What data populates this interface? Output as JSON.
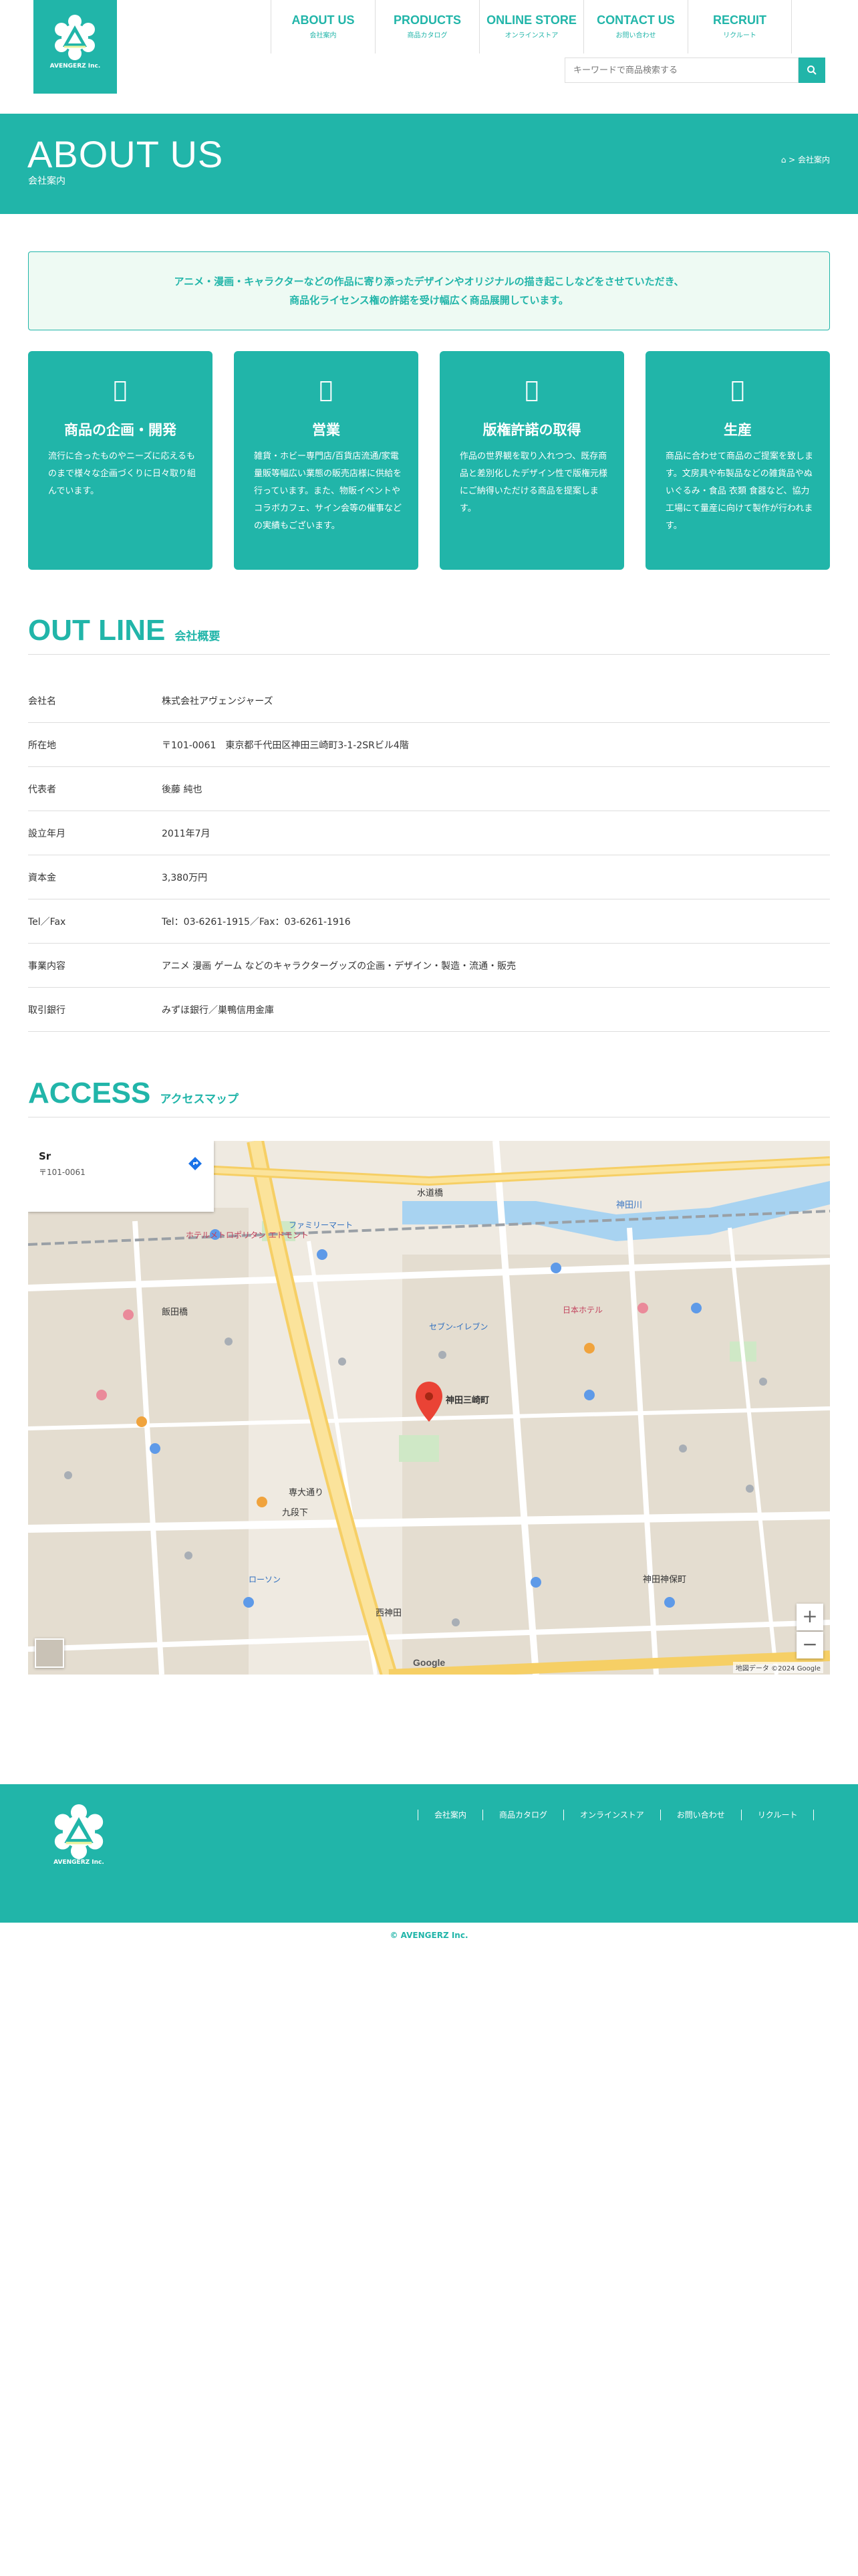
{
  "header": {
    "logo_text": "AVENGERZ Inc.",
    "nav": [
      {
        "en": "ABOUT US",
        "ja": "会社案内"
      },
      {
        "en": "PRODUCTS",
        "ja": "商品カタログ"
      },
      {
        "en": "ONLINE STORE",
        "ja": "オンラインストア"
      },
      {
        "en": "CONTACT US",
        "ja": "お問い合わせ"
      },
      {
        "en": "RECRUIT",
        "ja": "リクルート"
      }
    ],
    "search_placeholder": "キーワードで商品検索する"
  },
  "hero": {
    "title": "ABOUT US",
    "subtitle": "会社案内",
    "breadcrumb": "  > 会社案内"
  },
  "intro": {
    "line1": "アニメ・漫画・キャラクターなどの作品に寄り添ったデザインやオリジナルの描き起こしなどをさせていただき、",
    "line2": "商品化ライセンス権の許諾を受け幅広く商品展開しています。"
  },
  "services": [
    {
      "icon": "lightbulb-icon",
      "title": "商品の企画・開発",
      "desc": "流行に合ったものやニーズに応えるものまで様々な企画づくりに日々取り組んでいます。"
    },
    {
      "icon": "shop-icon",
      "title": "営業",
      "desc": "雑貨・ホビー専門店/百貨店流通/家電量販等幅広い業態の販売店様に供給を行っています。また、物販イベントやコラボカフェ、サイン会等の催事などの実績もございます。"
    },
    {
      "icon": "license-icon",
      "title": "版権許諾の取得",
      "desc": "作品の世界観を取り入れつつ、既存商品と差別化したデザイン性で版権元様にご納得いただける商品を提案します。"
    },
    {
      "icon": "factory-icon",
      "title": "生産",
      "desc": "商品に合わせて商品のご提案を致します。文房具や布製品などの雑貨品やぬいぐるみ・食品 衣類 食器など、協力工場にて量産に向けて製作が行われます。"
    }
  ],
  "outline": {
    "title_en": "OUT LINE",
    "title_ja": "会社概要",
    "rows": [
      {
        "k": "会社名",
        "v": "株式会社アヴェンジャーズ"
      },
      {
        "k": "所在地",
        "v": "〒101-0061　東京都千代田区神田三崎町3-1-2SRビル4階"
      },
      {
        "k": "代表者",
        "v": "後藤 純也"
      },
      {
        "k": "設立年月",
        "v": "2011年7月"
      },
      {
        "k": "資本金",
        "v": "3,380万円"
      },
      {
        "k": "Tel／Fax",
        "v": "Tel：03-6261-1915／Fax：03-6261-1916"
      },
      {
        "k": "事業内容",
        "v": "アニメ 漫画 ゲーム などのキャラクターグッズの企画・デザイン・製造・流通・販売"
      },
      {
        "k": "取引銀行",
        "v": "みずほ銀行／巣鴨信用金庫"
      }
    ]
  },
  "access": {
    "title_en": "ACCESS",
    "title_ja": "アクセスマップ",
    "map_card_title": "Sr",
    "map_card_address": "〒101-0061 ",
    "map_card_link": "",
    "zoom_in": "+",
    "zoom_out": "−",
    "google": "Google",
    "copyright": "地図データ ©2024 Google",
    "labels": {
      "suidobashi": "水道橋",
      "kanda_river": "神田川",
      "iidabashi": "飯田橋",
      "kudanshita": "九段下",
      "jimbocho": "神田神保町",
      "nishikanda": "西神田",
      "misaki": "神田三崎町",
      "sakaimachi": "専大通り",
      "family1": "ファミリーマート",
      "seven1": "セブン-イレブン",
      "lawson": "ローソン",
      "hotel": "ホテルメトロポリタン エドモント",
      "kaisha": "日本ホテル"
    }
  },
  "footer": {
    "logo_text": "AVENGERZ Inc.",
    "nav": [
      "会社案内",
      "商品カタログ",
      "オンラインストア",
      "お問い合わせ",
      "リクルート"
    ],
    "social": [
      "",
      ""
    ],
    "copyright": "© AVENGERZ Inc."
  },
  "colors": {
    "accent": "#21b5a9",
    "intro_bg": "#eefaf3"
  }
}
